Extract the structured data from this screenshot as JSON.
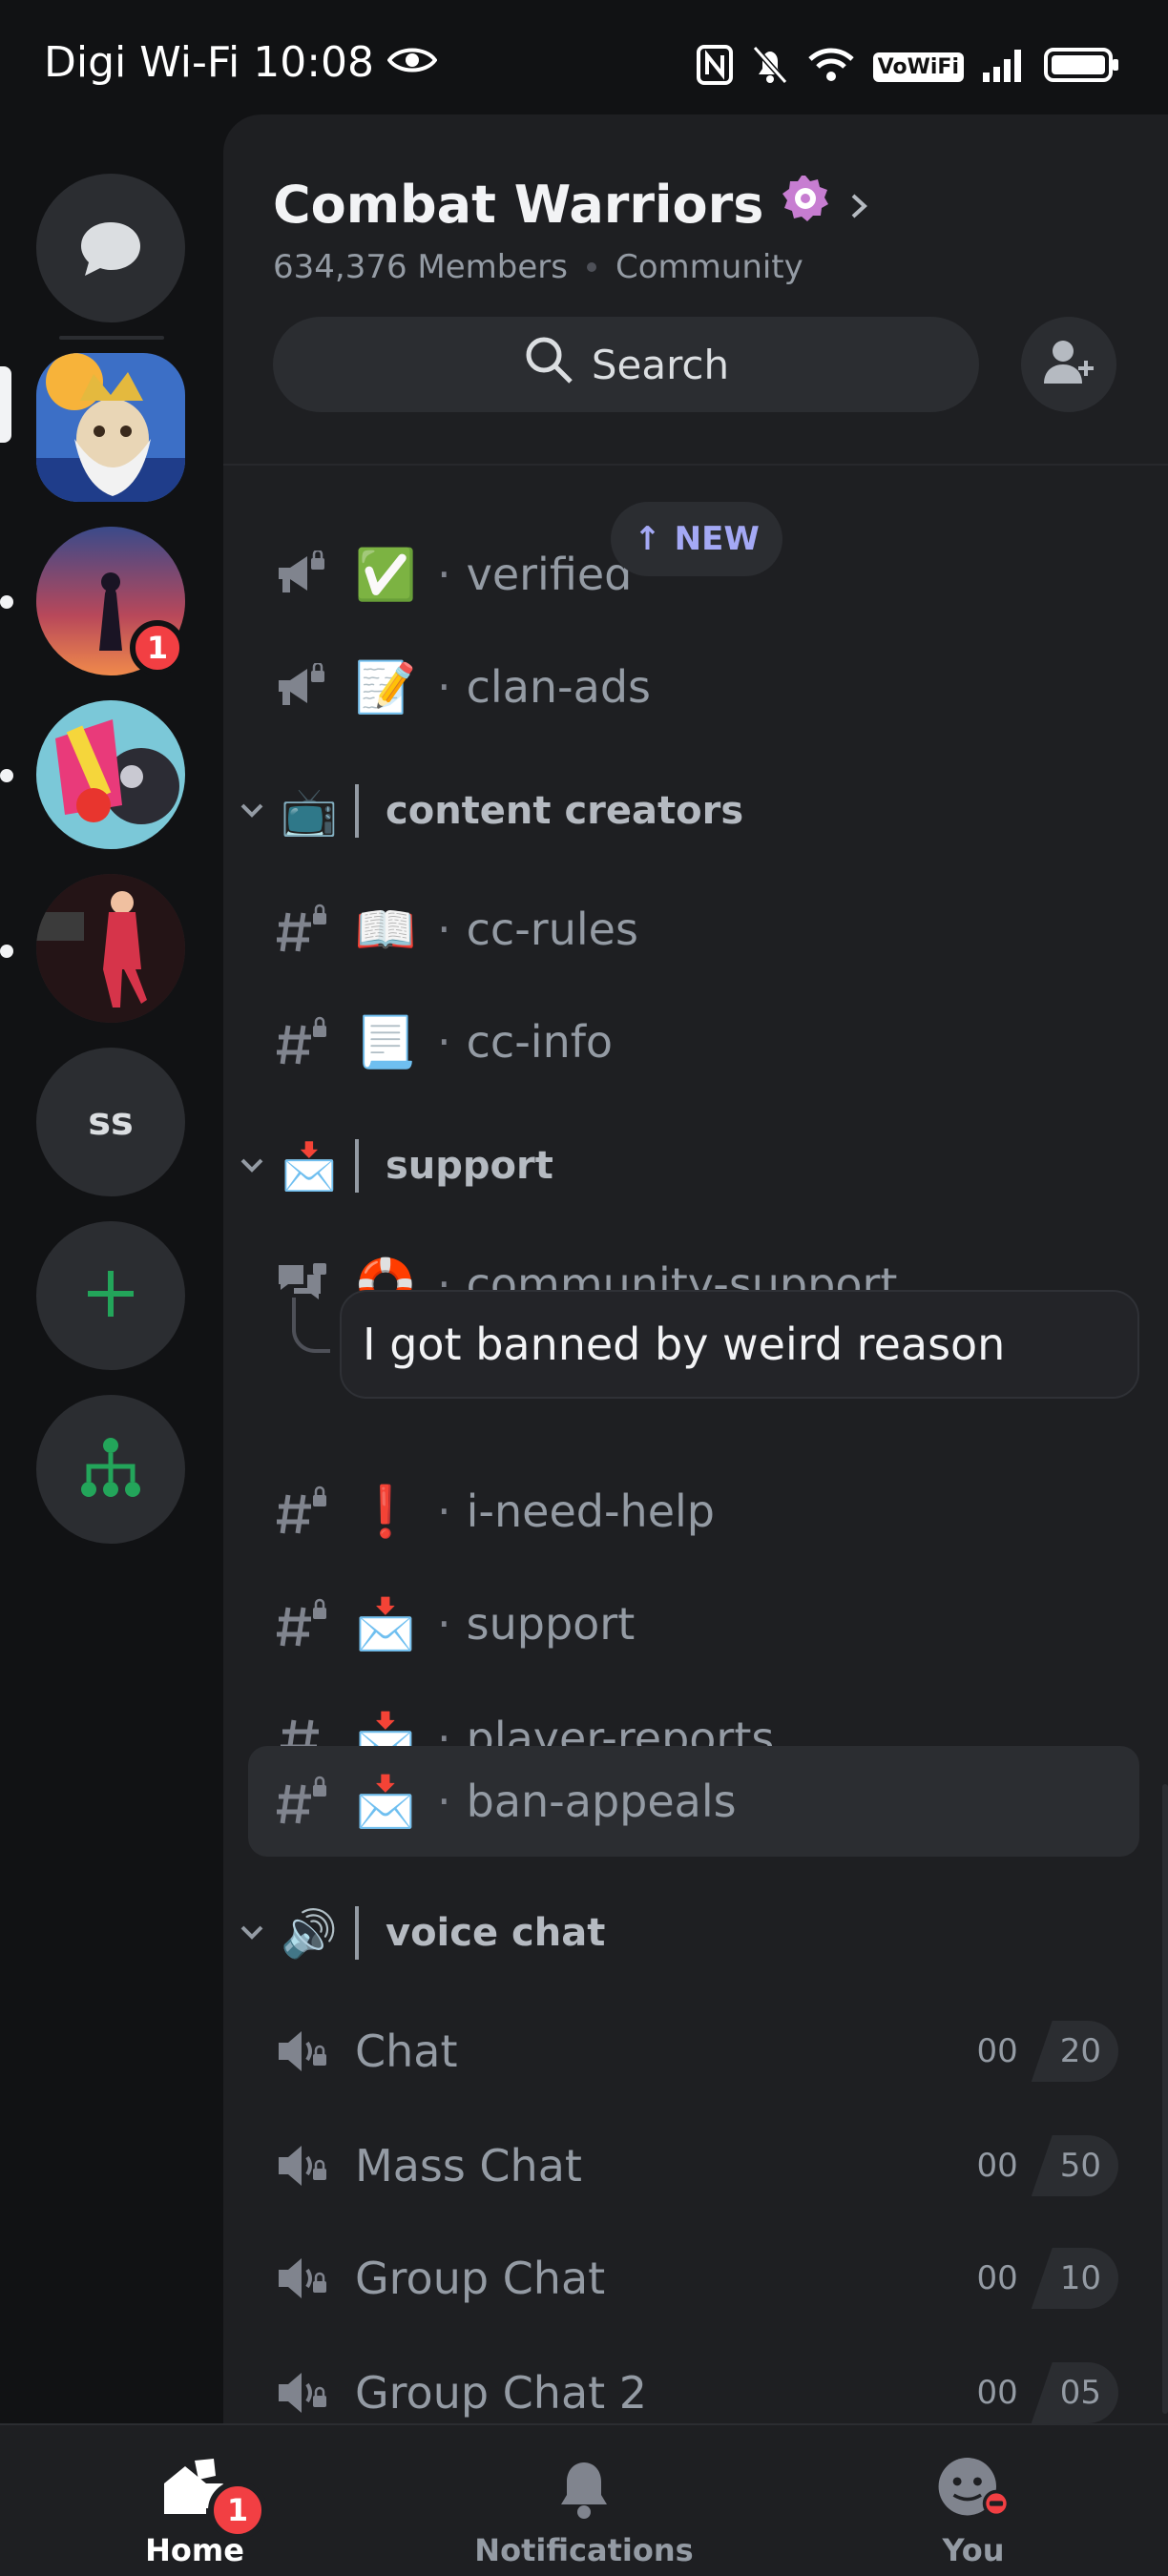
{
  "status_bar": {
    "carrier": "Digi Wi-Fi",
    "time": "10:08",
    "vowifi": "VoWiFi"
  },
  "rail": {
    "servers": [
      {
        "name": "dm",
        "badge": ""
      },
      {
        "name": "server-1",
        "badge": ""
      },
      {
        "name": "server-2",
        "badge": "1"
      },
      {
        "name": "server-3",
        "badge": ""
      },
      {
        "name": "server-4",
        "badge": ""
      },
      {
        "name": "server-ss",
        "label": "ss"
      }
    ]
  },
  "guild": {
    "name": "Combat Warriors",
    "members": "634,376 Members",
    "type": "Community",
    "search_label": "Search"
  },
  "new_pill": {
    "label": "NEW",
    "arrow": "↑"
  },
  "channels": {
    "verified": {
      "emoji": "✅",
      "name": "verified"
    },
    "clan_ads": {
      "emoji": "📝",
      "name": "clan-ads"
    },
    "cat_content": {
      "emoji": "📺",
      "title": "content creators"
    },
    "cc_rules": {
      "emoji": "📖",
      "name": "cc-rules"
    },
    "cc_info": {
      "emoji": "📃",
      "name": "cc-info"
    },
    "cat_support": {
      "emoji": "📩",
      "title": "support"
    },
    "community_support": {
      "emoji": "🛟",
      "name": "community-support"
    },
    "thread": {
      "title": "I got banned by weird reason"
    },
    "i_need_help": {
      "emoji": "❗",
      "name": "i-need-help"
    },
    "support": {
      "emoji": "📩",
      "name": "support"
    },
    "player_reports": {
      "emoji": "📩",
      "name": "player-reports"
    },
    "ban_appeals": {
      "emoji": "📩",
      "name": "ban-appeals"
    },
    "cat_voice": {
      "emoji": "🔊",
      "title": "voice chat"
    },
    "voice": [
      {
        "name": "Chat",
        "count": "00",
        "limit": "20"
      },
      {
        "name": "Mass Chat",
        "count": "00",
        "limit": "50"
      },
      {
        "name": "Group Chat",
        "count": "00",
        "limit": "10"
      },
      {
        "name": "Group Chat 2",
        "count": "00",
        "limit": "05"
      }
    ]
  },
  "bottom_nav": {
    "home": {
      "label": "Home",
      "badge": "1"
    },
    "notifications": {
      "label": "Notifications"
    },
    "you": {
      "label": "You"
    }
  },
  "colors": {
    "background": "#111214",
    "panel": "#1e1f22",
    "accent_new": "#a4a9f5",
    "badge_red": "#f23f43",
    "green": "#23a55a"
  }
}
